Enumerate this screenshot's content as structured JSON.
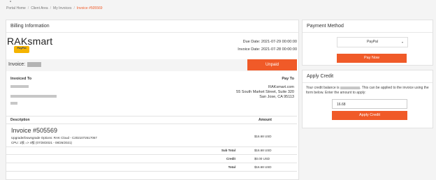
{
  "breadcrumb": [
    "Portal Home",
    "Client Area",
    "My Invoices",
    "Invoice #505569"
  ],
  "billing": {
    "header": "Billing Information",
    "logo_text": "RAKsmart",
    "paypal_badge": "PayPal",
    "due_date": "Due Date: 2021-07-29 00:00:00",
    "invoice_date": "Invoice Date: 2021-07-28 00:00:00",
    "invoice_label": "Invoice:",
    "status": "Unpaid",
    "invoiced_to": "Invoiced To",
    "pay_to": "Pay To",
    "pay_to_lines": [
      "RAKsmart.com",
      "55 South Market Street, Suite 320",
      "San Jose, CA 95113"
    ]
  },
  "items": {
    "col_description": "Description",
    "col_amount": "Amount",
    "title": "Invoice #505569",
    "desc_line1": "Upgrade/Downgrade Options: RAK Cloud - C2021072617067",
    "desc_line2": "CPU: 1核 => 4核 (07/28/2021 - 08/26/2021)",
    "amount": "$16.68 USD",
    "totals": [
      {
        "label": "Sub Total",
        "value": "$16.68 USD"
      },
      {
        "label": "Credit",
        "value": "$0.00 USD"
      },
      {
        "label": "Total",
        "value": "$16.68 USD"
      }
    ]
  },
  "payment": {
    "header": "Payment Method",
    "method": "PayPal",
    "pay_now": "Pay Now"
  },
  "credit": {
    "header": "Apply Credit",
    "text_before": "Your credit balance is",
    "text_after": ". This can be applied to the invoice using the form below. Enter the amount to apply:",
    "amount": "16.68",
    "button": "Apply Credit"
  },
  "colors": {
    "accent": "#f05a28"
  }
}
